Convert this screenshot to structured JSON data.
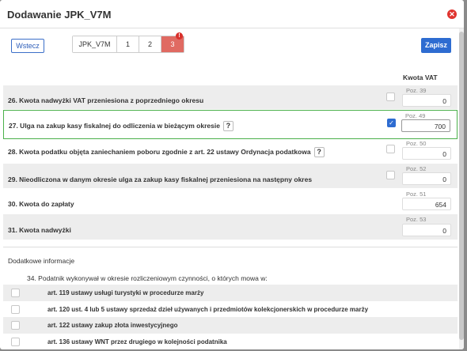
{
  "window": {
    "title": "Dodawanie JPK_V7M",
    "close_icon": "close-icon"
  },
  "toolbar": {
    "back_label": "Wstecz",
    "save_label": "Zapisz"
  },
  "tabs": [
    {
      "label": "JPK_V7M"
    },
    {
      "label": "1"
    },
    {
      "label": "2"
    },
    {
      "label": "3"
    }
  ],
  "tab_badge": "!",
  "column_header": "Kwota VAT",
  "rows": [
    {
      "label": "26. Kwota nadwyżki VAT przeniesiona z poprzedniego okresu",
      "poz": "Poz. 39",
      "value": "0",
      "checked": false,
      "help": false
    },
    {
      "label": "27. Ulga na zakup kasy fiskalnej do odliczenia w bieżącym okresie",
      "poz": "Poz. 49",
      "value": "700",
      "checked": true,
      "help": true
    },
    {
      "label": "28. Kwota podatku objęta zaniechaniem poboru zgodnie z art. 22 ustawy Ordynacja podatkowa",
      "poz": "Poz. 50",
      "value": "0",
      "checked": false,
      "help": true
    },
    {
      "label": "29. Nieodliczona w danym okresie ulga za zakup kasy fiskalnej przeniesiona na następny okres",
      "poz": "Poz. 52",
      "value": "0",
      "checked": false,
      "help": false
    },
    {
      "label": "30. Kwota do zapłaty",
      "poz": "Poz. 51",
      "value": "654"
    },
    {
      "label": "31. Kwota nadwyżki",
      "poz": "Poz. 53",
      "value": "0"
    }
  ],
  "help_glyph": "?",
  "additional": {
    "header": "Dodatkowe informacje",
    "question": "34. Podatnik wykonywał w okresie rozliczeniowym czynności, o których mowa w:",
    "options": [
      "art. 119 ustawy usługi turystyki w procedurze marży",
      "art. 120 ust. 4 lub 5 ustawy sprzedaż dzieł używanych i przedmiotów kolekcjonerskich w procedurze marży",
      "art. 122 ustawy zakup złota inwestycyjnego",
      "art. 136 ustawy WNT przez drugiego w kolejności podatnika"
    ]
  },
  "colors": {
    "accent": "#2e6cd1",
    "active_tab": "#e06a62",
    "selected_row_border": "#4ab04a",
    "close": "#e0342f"
  }
}
